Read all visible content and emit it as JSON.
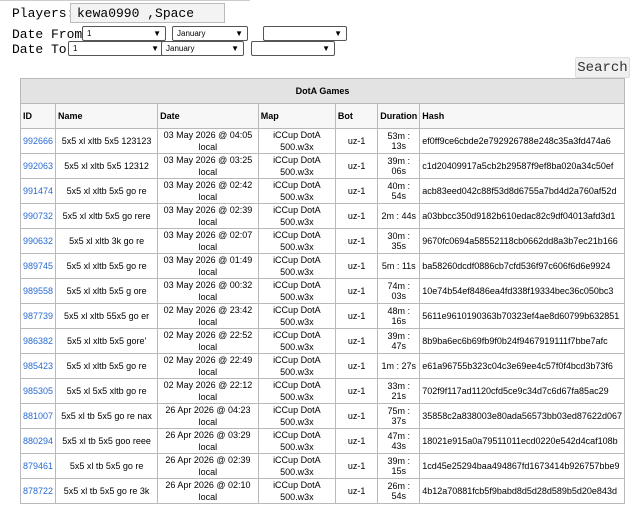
{
  "form": {
    "players_label": "Players:",
    "players_value": "kewa0990 ,Space",
    "date_from_label": "Date From:",
    "date_to_label": "Date To:",
    "from_day": "1",
    "from_month": "January",
    "from_year": "",
    "to_day": "1",
    "to_month": "January",
    "to_year": "",
    "search_label": "Search"
  },
  "table": {
    "title": "DotA Games",
    "headers": [
      "ID",
      "Name",
      "Date",
      "Map",
      "Bot",
      "Duration",
      "Hash"
    ],
    "rows": [
      {
        "id": "992666",
        "name": "5x5 xl xltb 5x5 123123",
        "date1": "03 May 2026 @ 04:05",
        "date2": "local",
        "map1": "iCCup DotA",
        "map2": "500.w3x",
        "bot": "uz-1",
        "duration": "53m : 13s",
        "hash": "ef0ff9ce6cbde2e792926788e248c35a3fd474a6"
      },
      {
        "id": "992063",
        "name": "5x5 xl xltb 5x5 12312",
        "date1": "03 May 2026 @ 03:25",
        "date2": "local",
        "map1": "iCCup DotA",
        "map2": "500.w3x",
        "bot": "uz-1",
        "duration": "39m : 06s",
        "hash": "c1d20409917a5cb2b29587f9ef8ba020a34c50ef"
      },
      {
        "id": "991474",
        "name": "5x5 xl xltb 5x5 go re",
        "date1": "03 May 2026 @ 02:42",
        "date2": "local",
        "map1": "iCCup DotA",
        "map2": "500.w3x",
        "bot": "uz-1",
        "duration": "40m : 54s",
        "hash": "acb83eed042c88f53d8d6755a7bd4d2a760af52d"
      },
      {
        "id": "990732",
        "name": "5x5 xl xltb 5x5 go rere",
        "date1": "03 May 2026 @ 02:39",
        "date2": "local",
        "map1": "iCCup DotA",
        "map2": "500.w3x",
        "bot": "uz-1",
        "duration": "2m : 44s",
        "hash": "a03bbcc350d9182b610edac82c9df04013afd3d1"
      },
      {
        "id": "990632",
        "name": "5x5 xl xltb 3k go re",
        "date1": "03 May 2026 @ 02:07",
        "date2": "local",
        "map1": "iCCup DotA",
        "map2": "500.w3x",
        "bot": "uz-1",
        "duration": "30m : 35s",
        "hash": "9670fc0694a58552118cb0662dd8a3b7ec21b166"
      },
      {
        "id": "989745",
        "name": "5x5 xl xltb 5x5 go re",
        "date1": "03 May 2026 @ 01:49",
        "date2": "local",
        "map1": "iCCup DotA",
        "map2": "500.w3x",
        "bot": "uz-1",
        "duration": "5m : 11s",
        "hash": "ba58260dcdf0886cb7cfd536f97c606f6d6e9924"
      },
      {
        "id": "989558",
        "name": "5x5 xl xltb 5x5 g ore",
        "date1": "03 May 2026 @ 00:32",
        "date2": "local",
        "map1": "iCCup DotA",
        "map2": "500.w3x",
        "bot": "uz-1",
        "duration": "74m : 03s",
        "hash": "10e74b54ef8486ea4fd338f19334bec36c050bc3"
      },
      {
        "id": "987739",
        "name": "5x5 xl xltb 55x5 go er",
        "date1": "02 May 2026 @ 23:42",
        "date2": "local",
        "map1": "iCCup DotA",
        "map2": "500.w3x",
        "bot": "uz-1",
        "duration": "48m : 16s",
        "hash": "5611e9610190363b70323ef4ae8d60799b632851"
      },
      {
        "id": "986382",
        "name": "5x5 xl xltb 5x5 gore'",
        "date1": "02 May 2026 @ 22:52",
        "date2": "local",
        "map1": "iCCup DotA",
        "map2": "500.w3x",
        "bot": "uz-1",
        "duration": "39m : 47s",
        "hash": "8b9ba6ec6b69fb9f0b24f9467919111f7bbe7afc"
      },
      {
        "id": "985423",
        "name": "5x5 xl xltb 5x5 go re",
        "date1": "02 May 2026 @ 22:49",
        "date2": "local",
        "map1": "iCCup DotA",
        "map2": "500.w3x",
        "bot": "uz-1",
        "duration": "1m : 27s",
        "hash": "e61a96755b323c04c3e69ee4c57f0f4bcd3b73f6"
      },
      {
        "id": "985305",
        "name": "5x5 xl 5x5 xltb go re",
        "date1": "02 May 2026 @ 22:12",
        "date2": "local",
        "map1": "iCCup DotA",
        "map2": "500.w3x",
        "bot": "uz-1",
        "duration": "33m : 21s",
        "hash": "702f9f117ad1120cfd5ce9c34d7c6d67fa85ac29"
      },
      {
        "id": "881007",
        "name": "5x5 xl tb 5x5 go re nax",
        "date1": "26 Apr 2026 @ 04:23 local",
        "date2": "",
        "map1": "iCCup DotA",
        "map2": "500.w3x",
        "bot": "uz-1",
        "duration": "75m : 37s",
        "hash": "35858c2a838003e80ada56573bb03ed87622d067"
      },
      {
        "id": "880294",
        "name": "5x5 xl tb 5x5 goo reee",
        "date1": "26 Apr 2026 @ 03:29 local",
        "date2": "",
        "map1": "iCCup DotA",
        "map2": "500.w3x",
        "bot": "uz-1",
        "duration": "47m : 43s",
        "hash": "18021e915a0a79511011ecd0220e542d4caf108b"
      },
      {
        "id": "879461",
        "name": "5x5 xl tb 5x5 go re",
        "date1": "26 Apr 2026 @ 02:39 local",
        "date2": "",
        "map1": "iCCup DotA",
        "map2": "500.w3x",
        "bot": "uz-1",
        "duration": "39m : 15s",
        "hash": "1cd45e25294baa494867fd1673414b926757bbe9"
      },
      {
        "id": "878722",
        "name": "5x5 xl tb 5x5 go re 3k",
        "date1": "26 Apr 2026 @ 02:10 local",
        "date2": "",
        "map1": "iCCup DotA",
        "map2": "500.w3x",
        "bot": "uz-1",
        "duration": "26m : 54s",
        "hash": "4b12a70881fcb5f9babd8d5d28d589b5d20e843d"
      }
    ]
  }
}
